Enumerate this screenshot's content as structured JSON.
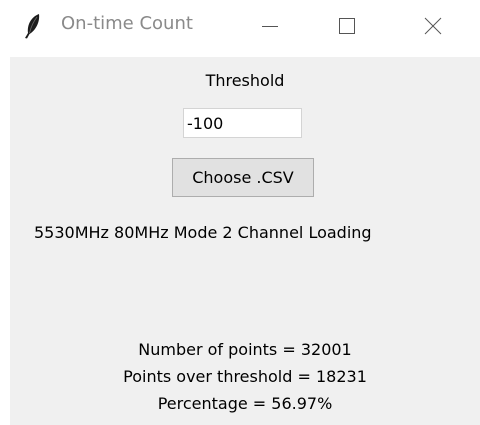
{
  "window": {
    "title": "On-time Count",
    "icon": "feather-icon",
    "controls": {
      "minimize_icon": "minimize-icon",
      "maximize_icon": "maximize-icon",
      "close_icon": "close-icon"
    }
  },
  "form": {
    "threshold_label": "Threshold",
    "threshold_value": "-100",
    "choose_button_label": "Choose .CSV",
    "status_text": "5530MHz 80MHz Mode 2 Channel Loading"
  },
  "results": {
    "points_text": "Number of points = 32001",
    "over_threshold_text": "Points over threshold = 18231",
    "percentage_text": "Percentage = 56.97%"
  },
  "colors": {
    "client_background": "#f0f0f0",
    "titlebar_background": "#ffffff",
    "title_text": "#8a8a8a",
    "button_background": "#e1e1e1"
  }
}
